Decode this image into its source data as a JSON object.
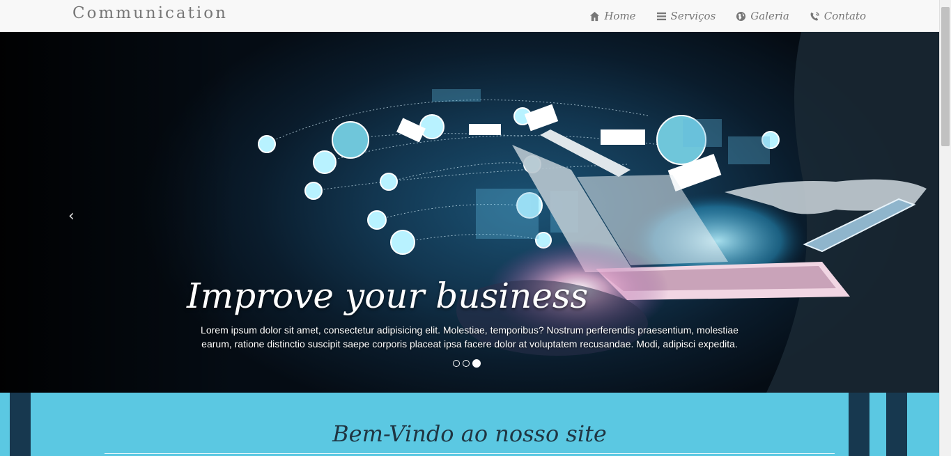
{
  "navbar": {
    "brand": "Communication",
    "items": [
      {
        "label": "Home",
        "icon": "home-icon"
      },
      {
        "label": "Serviços",
        "icon": "list-icon"
      },
      {
        "label": "Galeria",
        "icon": "globe-icon"
      },
      {
        "label": "Contato",
        "icon": "phone-icon"
      }
    ]
  },
  "carousel": {
    "prev_arrow": "‹",
    "title": "Improve your business",
    "text": "Lorem ipsum dolor sit amet, consectetur adipisicing elit. Molestiae, temporibus? Nostrum perferendis praesentium, molestiae earum, ratione distinctio suscipit saepe corporis placeat ipsa facere dolor at voluptatem recusandae. Modi, adipisci expedita.",
    "slide_count": 3,
    "active_slide": 3
  },
  "welcome": {
    "title": "Bem-Vindo ao nosso site"
  },
  "colors": {
    "navbar_bg": "#f8f8f8",
    "welcome_bg": "#5bc8e2",
    "hero_dark": "#0a1c2c",
    "accent_glow": "#a8eef5"
  }
}
